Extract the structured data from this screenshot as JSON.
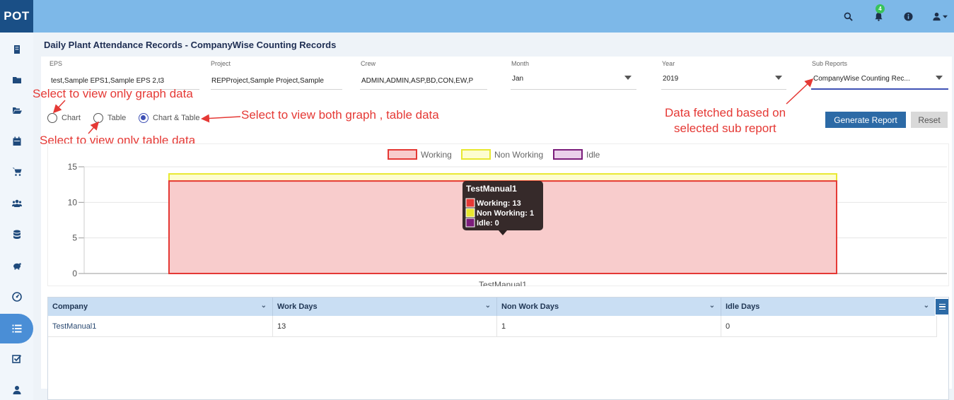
{
  "app": {
    "logo_text": "POT"
  },
  "header": {
    "notification_count": "4",
    "icons": [
      "search-icon",
      "bell-icon",
      "info-icon",
      "user-icon",
      "caret-down-icon"
    ]
  },
  "sidebar": {
    "items": [
      {
        "icon": "building-icon"
      },
      {
        "icon": "folder-icon"
      },
      {
        "icon": "folder-open-icon"
      },
      {
        "icon": "calendar-icon"
      },
      {
        "icon": "cart-icon"
      },
      {
        "icon": "users-icon"
      },
      {
        "icon": "database-icon"
      },
      {
        "icon": "piggy-bank-icon"
      },
      {
        "icon": "dashboard-icon"
      },
      {
        "icon": "list-icon",
        "active": true
      },
      {
        "icon": "check-square-icon"
      },
      {
        "icon": "user-icon"
      }
    ]
  },
  "page": {
    "title": "Daily Plant Attendance Records - CompanyWise Counting Records"
  },
  "filters": {
    "eps": {
      "label": "EPS",
      "value": "test,Sample EPS1,Sample EPS 2,t3"
    },
    "project": {
      "label": "Project",
      "value": "REPProject,Sample Project,Sample"
    },
    "crew": {
      "label": "Crew",
      "value": "ADMIN,ADMIN,ASP,BD,CON,EW,P"
    },
    "month": {
      "label": "Month",
      "value": "Jan"
    },
    "year": {
      "label": "Year",
      "value": "2019"
    },
    "sub_reports": {
      "label": "Sub Reports",
      "value": "CompanyWise Counting Rec..."
    }
  },
  "view_options": {
    "chart": "Chart",
    "table": "Table",
    "chart_table": "Chart & Table",
    "selected": "chart_table"
  },
  "buttons": {
    "generate": "Generate Report",
    "reset": "Reset"
  },
  "annotations": {
    "graph_only": "Select to view only graph data",
    "table_only": "Select to view only table data",
    "both": "Select to view both graph , table data",
    "fetched_line1": "Data fetched based on",
    "fetched_line2": "selected sub report"
  },
  "chart_data": {
    "type": "bar",
    "stacked": false,
    "categories": [
      "TestManual1"
    ],
    "series": [
      {
        "name": "Working",
        "values": [
          13
        ],
        "color": "#e53935",
        "fill": "#f8cccc"
      },
      {
        "name": "Non Working",
        "values": [
          1
        ],
        "color": "#e8e830",
        "fill": "#fdfdd0"
      },
      {
        "name": "Idle",
        "values": [
          0
        ],
        "color": "#7b1d7b",
        "fill": "#ead0ea"
      }
    ],
    "ylim": [
      0,
      15
    ],
    "yticks": [
      "0",
      "5",
      "10",
      "15"
    ],
    "legend": "top-center",
    "grid": true,
    "tooltip": {
      "title": "TestManual1",
      "lines": [
        "Working: 13",
        "Non Working: 1",
        "Idle: 0"
      ]
    }
  },
  "table": {
    "columns": [
      "Company",
      "Work Days",
      "Non Work Days",
      "Idle Days"
    ],
    "rows": [
      [
        "TestManual1",
        "13",
        "1",
        "0"
      ]
    ]
  }
}
